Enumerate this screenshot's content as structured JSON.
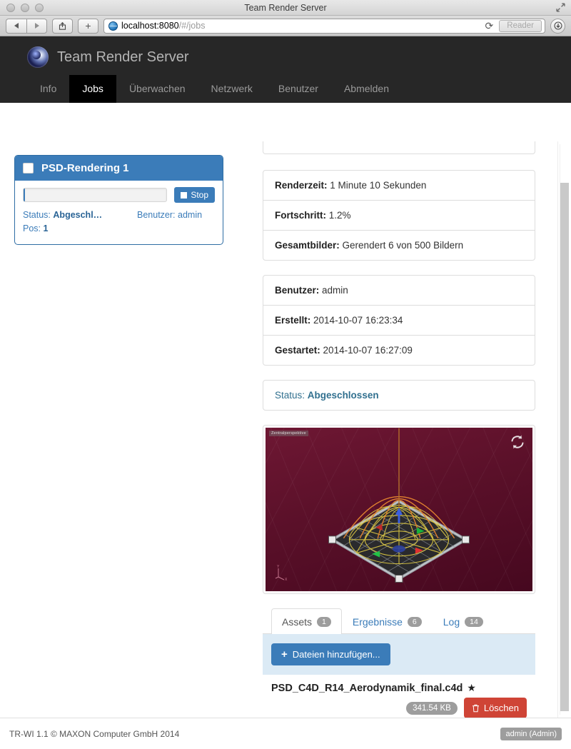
{
  "window": {
    "title": "Team Render Server",
    "fullscreen_icon": "fullscreen-icon"
  },
  "browser": {
    "back_icon": "back-arrow-icon",
    "forward_icon": "forward-arrow-icon",
    "share_icon": "share-icon",
    "newtab_label": "+",
    "site_icon": "globe-icon",
    "url_host": "localhost:8080",
    "url_path": "/#/jobs",
    "reload_icon": "reload-icon",
    "reader_label": "Reader",
    "download_icon": "download-icon"
  },
  "app": {
    "brand_title": "Team Render Server",
    "logo_icon": "cinema4d-logo-icon",
    "nav": [
      {
        "label": "Info",
        "active": false
      },
      {
        "label": "Jobs",
        "active": true
      },
      {
        "label": "Überwachen",
        "active": false
      },
      {
        "label": "Netzwerk",
        "active": false
      },
      {
        "label": "Benutzer",
        "active": false
      },
      {
        "label": "Abmelden",
        "active": false
      }
    ]
  },
  "sidebar": {
    "job": {
      "title": "PSD-Rendering 1",
      "checkbox_icon": "checkbox-icon",
      "progress_percent": 1.2,
      "stop_label": "Stop",
      "stop_icon": "stop-square-icon",
      "status_label": "Status:",
      "status_value": "Abgeschl…",
      "user_label": "Benutzer:",
      "user_value": "admin",
      "pos_label": "Pos:",
      "pos_value": "1"
    }
  },
  "detail": {
    "rows_group_1": [
      {
        "label": "Renderzeit:",
        "value": "1 Minute 10 Sekunden"
      },
      {
        "label": "Fortschritt:",
        "value": "1.2%"
      },
      {
        "label": "Gesamtbilder:",
        "value": "Gerendert 6 von 500 Bildern"
      }
    ],
    "rows_group_2": [
      {
        "label": "Benutzer:",
        "value": "admin"
      },
      {
        "label": "Erstellt:",
        "value": "2014-10-07 16:23:34"
      },
      {
        "label": "Gestartet:",
        "value": "2014-10-07 16:27:09"
      }
    ],
    "status": {
      "label": "Status:",
      "value": "Abgeschlossen"
    },
    "preview": {
      "viewport_label": "Zentralperspektive",
      "refresh_icon": "refresh-icon",
      "axis_icon": "axis-gizmo-icon"
    },
    "tabs": [
      {
        "label": "Assets",
        "count": "1",
        "active": true
      },
      {
        "label": "Ergebnisse",
        "count": "6",
        "active": false
      },
      {
        "label": "Log",
        "count": "14",
        "active": false
      }
    ],
    "assets_panel": {
      "add_files_label": "Dateien hinzufügen...",
      "add_files_icon": "plus-icon",
      "file_name": "PSD_C4D_R14_Aerodynamik_final.c4d",
      "star_icon": "star-icon",
      "file_size": "341.54 KB",
      "delete_label": "Löschen",
      "delete_icon": "trash-icon"
    }
  },
  "footer": {
    "copyright": "TR-WI 1.1 © MAXON Computer GmbH 2014",
    "user_badge": "admin (Admin)"
  },
  "colors": {
    "accent_blue": "#3b7cb9",
    "danger_red": "#cf4436",
    "nav_dark": "#272727",
    "nav_active": "#000000",
    "badge_gray": "#9d9d9d",
    "status_blue": "#31708f"
  }
}
